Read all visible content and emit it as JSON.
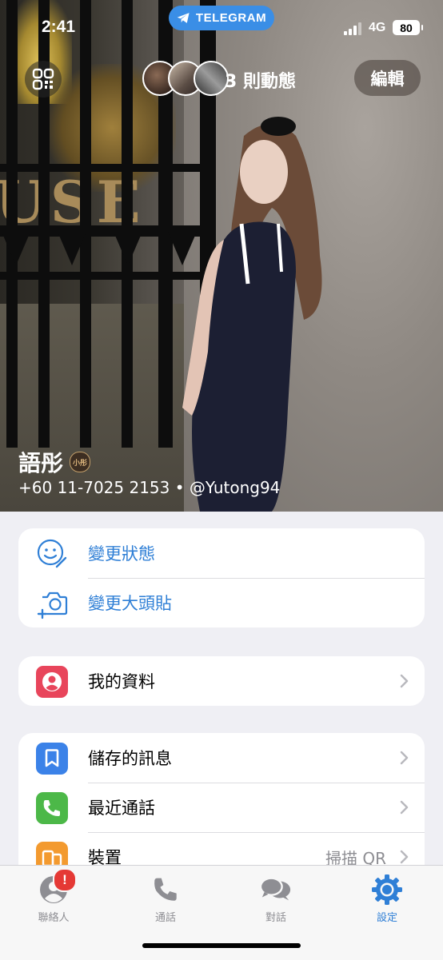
{
  "status_bar": {
    "time": "2:41",
    "app_pill": "TELEGRAM",
    "network": "4G",
    "battery": "80"
  },
  "profile": {
    "stories_label": "3 則動態",
    "edit_label": "編輯",
    "name": "語彤",
    "badge_text": "小彤",
    "subtitle": "+60 11-7025 2153 • @Yutong94"
  },
  "actions": [
    {
      "label": "變更狀態",
      "icon": "smiley-edit-icon"
    },
    {
      "label": "變更大頭貼",
      "icon": "camera-add-icon"
    }
  ],
  "my_profile": {
    "label": "我的資料",
    "icon": "person-icon",
    "color": "#e8455b"
  },
  "menu": [
    {
      "label": "儲存的訊息",
      "icon": "bookmark-icon",
      "color": "#3b82e8"
    },
    {
      "label": "最近通話",
      "icon": "phone-icon",
      "color": "#4cb848"
    },
    {
      "label": "裝置",
      "value": "掃描 QR",
      "icon": "devices-icon",
      "color": "#f39a2f"
    }
  ],
  "tabs": [
    {
      "label": "聯絡人",
      "icon": "contacts-icon",
      "badge": "!"
    },
    {
      "label": "通話",
      "icon": "phone-icon"
    },
    {
      "label": "對話",
      "icon": "chats-icon"
    },
    {
      "label": "設定",
      "icon": "settings-gear-icon",
      "active": true
    }
  ],
  "colors": {
    "accent": "#2f7fd6",
    "background": "#efeff4",
    "telegram_pill": "#3a8ee6",
    "notification_red": "#e53935"
  }
}
